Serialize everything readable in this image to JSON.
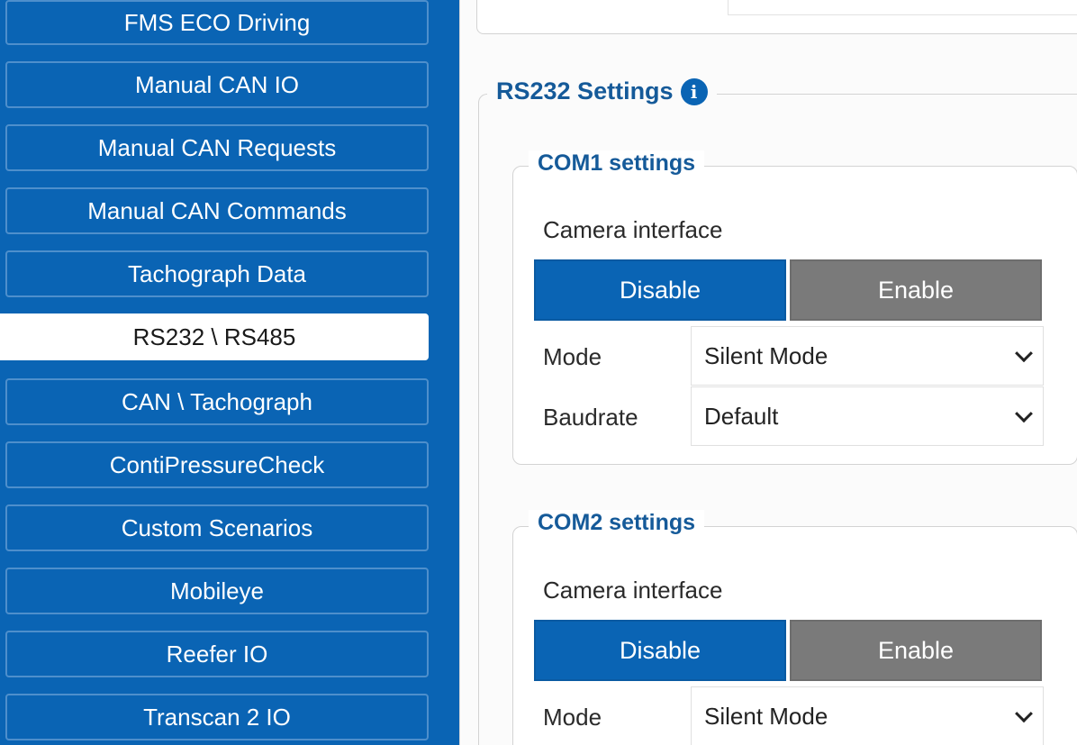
{
  "sidebar": {
    "items": [
      {
        "label": "FMS ECO Driving",
        "active": false
      },
      {
        "label": "Manual CAN IO",
        "active": false
      },
      {
        "label": "Manual CAN Requests",
        "active": false
      },
      {
        "label": "Manual CAN Commands",
        "active": false
      },
      {
        "label": "Tachograph Data",
        "active": false
      },
      {
        "label": "RS232 \\ RS485",
        "active": true
      },
      {
        "label": "CAN \\ Tachograph",
        "active": false
      },
      {
        "label": "ContiPressureCheck",
        "active": false
      },
      {
        "label": "Custom Scenarios",
        "active": false
      },
      {
        "label": "Mobileye",
        "active": false
      },
      {
        "label": "Reefer IO",
        "active": false
      },
      {
        "label": "Transcan 2 IO",
        "active": false
      }
    ]
  },
  "rs232": {
    "title": "RS232 Settings",
    "info_icon": "info-icon",
    "com1": {
      "title": "COM1 settings",
      "camera_label": "Camera interface",
      "disable_label": "Disable",
      "enable_label": "Enable",
      "selected": "Disable",
      "mode_label": "Mode",
      "mode_value": "Silent Mode",
      "baudrate_label": "Baudrate",
      "baudrate_value": "Default"
    },
    "com2": {
      "title": "COM2 settings",
      "camera_label": "Camera interface",
      "disable_label": "Disable",
      "enable_label": "Enable",
      "selected": "Disable",
      "mode_label": "Mode",
      "mode_value": "Silent Mode"
    }
  },
  "colors": {
    "sidebar_bg": "#0a64b4",
    "active_button": "#0a64b4",
    "inactive_button": "#7a7a7a",
    "legend_text": "#155a99"
  }
}
